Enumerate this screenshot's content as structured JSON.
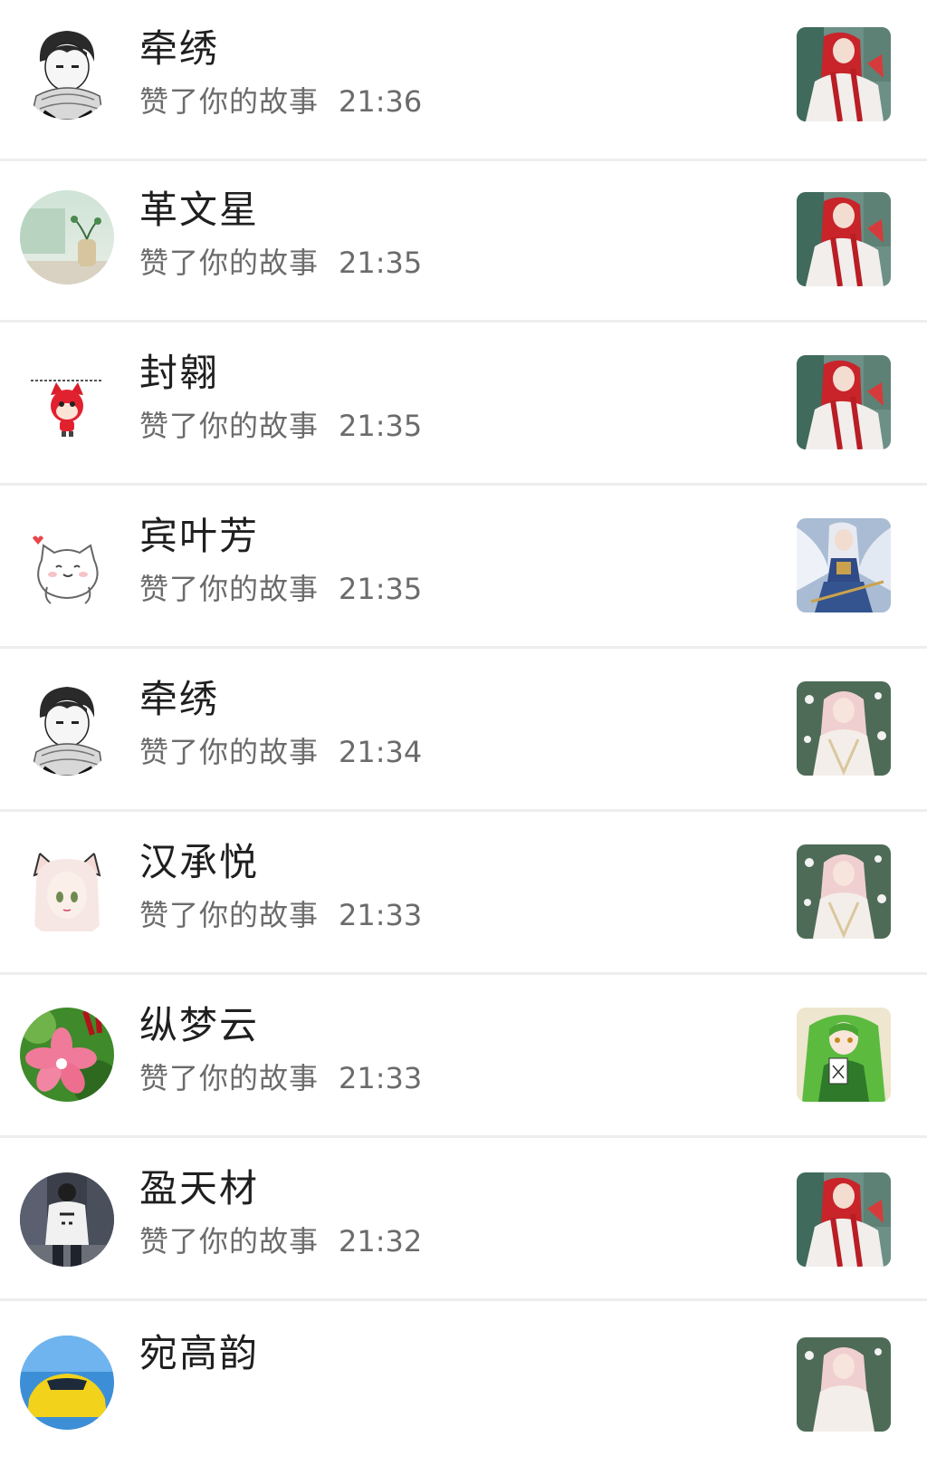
{
  "notifications": [
    {
      "name": "牵绣",
      "action": "赞了你的故事",
      "time": "21:36",
      "avatar_icon": "anime-boy-scarf-avatar",
      "thumb_icon": "red-white-girl-thumbnail"
    },
    {
      "name": "革文星",
      "action": "赞了你的故事",
      "time": "21:35",
      "avatar_icon": "plant-vase-avatar",
      "thumb_icon": "red-white-girl-thumbnail"
    },
    {
      "name": "封翱",
      "action": "赞了你的故事",
      "time": "21:35",
      "avatar_icon": "red-fox-cartoon-avatar",
      "thumb_icon": "red-white-girl-thumbnail"
    },
    {
      "name": "宾叶芳",
      "action": "赞了你的故事",
      "time": "21:35",
      "avatar_icon": "white-cat-heart-avatar",
      "thumb_icon": "angel-warrior-thumbnail"
    },
    {
      "name": "牵绣",
      "action": "赞了你的故事",
      "time": "21:34",
      "avatar_icon": "anime-boy-scarf-avatar",
      "thumb_icon": "pink-hair-girl-thumbnail"
    },
    {
      "name": "汉承悦",
      "action": "赞了你的故事",
      "time": "21:33",
      "avatar_icon": "cat-ear-girl-avatar",
      "thumb_icon": "pink-hair-girl-thumbnail"
    },
    {
      "name": "纵梦云",
      "action": "赞了你的故事",
      "time": "21:33",
      "avatar_icon": "pink-flower-avatar",
      "thumb_icon": "green-hair-girl-thumbnail"
    },
    {
      "name": "盈天材",
      "action": "赞了你的故事",
      "time": "21:32",
      "avatar_icon": "street-person-avatar",
      "thumb_icon": "red-white-girl-thumbnail"
    },
    {
      "name": "宛高韵",
      "action": "",
      "time": "",
      "avatar_icon": "yellow-car-avatar",
      "thumb_icon": "pink-hair-girl-thumbnail"
    }
  ],
  "colors": {
    "name": "#1f1f1f",
    "subtext": "#6b6b6b",
    "divider": "#eeeeee",
    "background": "#ffffff"
  }
}
